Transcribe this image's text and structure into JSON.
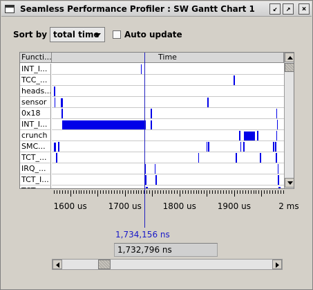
{
  "window": {
    "title": "Seamless Performance Profiler : SW Gantt Chart 1",
    "buttons": [
      "minimize-icon",
      "maximize-icon",
      "close-icon"
    ]
  },
  "toolbar": {
    "sort_label": "Sort by :",
    "sort_value": "total time",
    "auto_update_label": "Auto update",
    "auto_update_checked": false
  },
  "gantt": {
    "column_function": "Functi...",
    "column_time": "Time",
    "rows": [
      {
        "label": "INT_I...",
        "marks": [
          [
            1728,
            1729
          ]
        ]
      },
      {
        "label": "TCC_...",
        "marks": [
          [
            1898,
            1899
          ]
        ]
      },
      {
        "label": "heads...",
        "marks": [
          [
            1569,
            1570
          ]
        ]
      },
      {
        "label": "sensor",
        "marks": [
          [
            1570,
            1571
          ],
          [
            1582,
            1585
          ],
          [
            1850,
            1851
          ]
        ]
      },
      {
        "label": "0x18",
        "marks": [
          [
            1583,
            1584
          ],
          [
            1746,
            1747
          ],
          [
            1976,
            1977
          ]
        ]
      },
      {
        "label": "INT_I...",
        "marks": [
          [
            1584,
            1737
          ],
          [
            1746,
            1749
          ],
          [
            1977,
            1979
          ]
        ]
      },
      {
        "label": "crunch",
        "marks": [
          [
            1908,
            1909
          ],
          [
            1917,
            1937
          ],
          [
            1941,
            1942
          ],
          [
            1976,
            1977
          ]
        ]
      },
      {
        "label": "SMC...",
        "marks": [
          [
            1569,
            1572
          ],
          [
            1577,
            1578
          ],
          [
            1848,
            1849
          ],
          [
            1851,
            1852
          ],
          [
            1910,
            1911
          ],
          [
            1916,
            1917
          ],
          [
            1970,
            1971
          ],
          [
            1974,
            1975
          ]
        ]
      },
      {
        "label": "TCT_...",
        "marks": [
          [
            1573,
            1574
          ],
          [
            1833,
            1834
          ],
          [
            1902,
            1903
          ],
          [
            1946,
            1947
          ],
          [
            1975,
            1976
          ]
        ]
      },
      {
        "label": "IRQ_...",
        "marks": [
          [
            1735,
            1736
          ],
          [
            1753,
            1754
          ],
          [
            1978,
            1979
          ]
        ]
      },
      {
        "label": "TCT_I...",
        "marks": [
          [
            1736,
            1737
          ],
          [
            1755,
            1756
          ],
          [
            1979,
            1980
          ]
        ]
      },
      {
        "label": "TCT...",
        "marks": [
          [
            1737,
            1741
          ],
          [
            1980,
            1984
          ]
        ]
      }
    ],
    "x_range_us": [
      1565,
      1990
    ],
    "cursor_us": 1734.156,
    "ticks": [
      {
        "value": 1600,
        "label": "1600 us"
      },
      {
        "value": 1700,
        "label": "1700 us"
      },
      {
        "value": 1800,
        "label": "1800 us"
      },
      {
        "value": 1900,
        "label": "1900 us"
      },
      {
        "value": 2000,
        "label": "2 ms"
      }
    ],
    "mark_color": "#0000e8"
  },
  "cursor_readout": "1,734,156 ns",
  "time_field_value": "1,732,796 ns",
  "hscroll_position": 0.18,
  "vscroll_position": 0.0
}
